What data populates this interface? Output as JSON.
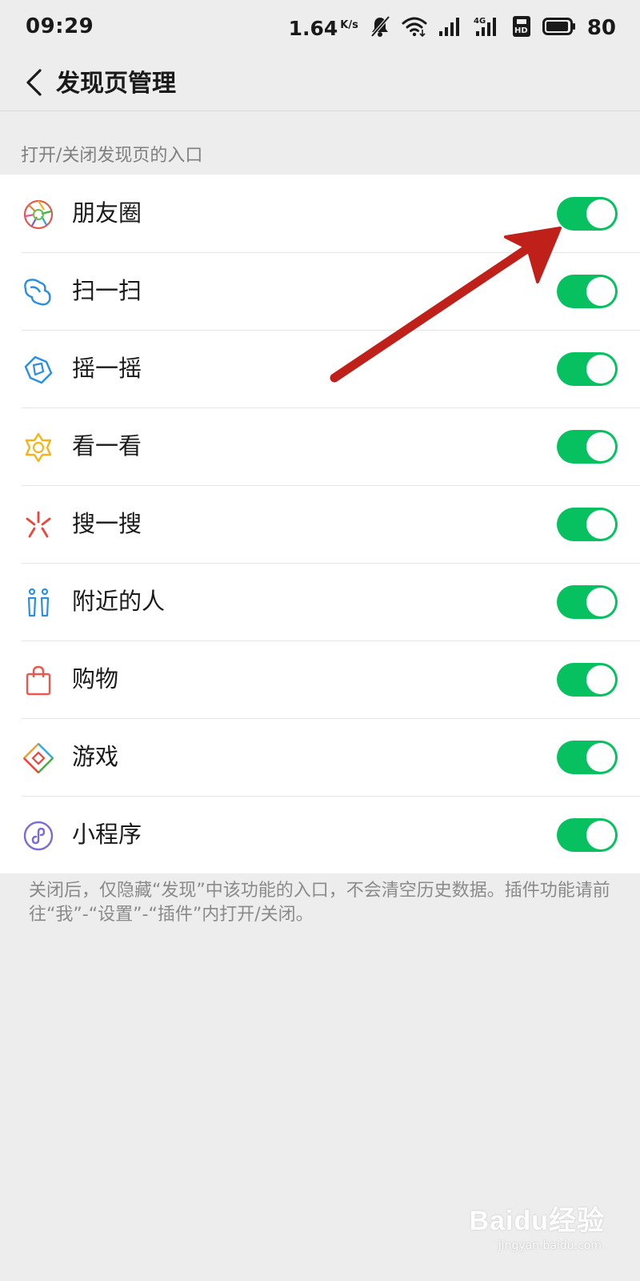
{
  "status_bar": {
    "time": "09:29",
    "net_speed": "1.64",
    "net_unit": "K/s",
    "battery": "80",
    "icons": [
      "mute-bell-icon",
      "wifi-icon",
      "signal-icon",
      "signal-4g-icon",
      "hd-icon",
      "battery-icon"
    ]
  },
  "header": {
    "title": "发现页管理",
    "back_icon": "chevron-left-icon"
  },
  "section_header": "打开/关闭发现页的入口",
  "items": [
    {
      "label": "朋友圈",
      "icon": "moments-aperture-icon",
      "enabled": true
    },
    {
      "label": "扫一扫",
      "icon": "scan-icon",
      "enabled": true
    },
    {
      "label": "摇一摇",
      "icon": "shake-icon",
      "enabled": true
    },
    {
      "label": "看一看",
      "icon": "look-star-icon",
      "enabled": true
    },
    {
      "label": "搜一搜",
      "icon": "search-spark-icon",
      "enabled": true
    },
    {
      "label": "附近的人",
      "icon": "nearby-people-icon",
      "enabled": true
    },
    {
      "label": "购物",
      "icon": "shopping-bag-icon",
      "enabled": true
    },
    {
      "label": "游戏",
      "icon": "game-diamond-icon",
      "enabled": true
    },
    {
      "label": "小程序",
      "icon": "mini-program-icon",
      "enabled": true
    }
  ],
  "footer_note": "关闭后，仅隐藏“发现”中该功能的入口，不会清空历史数据。插件功能请前往“我”-“设置”-“插件”内打开/关闭。",
  "annotation_color": "#c0201a",
  "accent_color": "#07c160",
  "watermark": {
    "brand": "Baidu经验",
    "url": "jingyan.baidu.com"
  }
}
